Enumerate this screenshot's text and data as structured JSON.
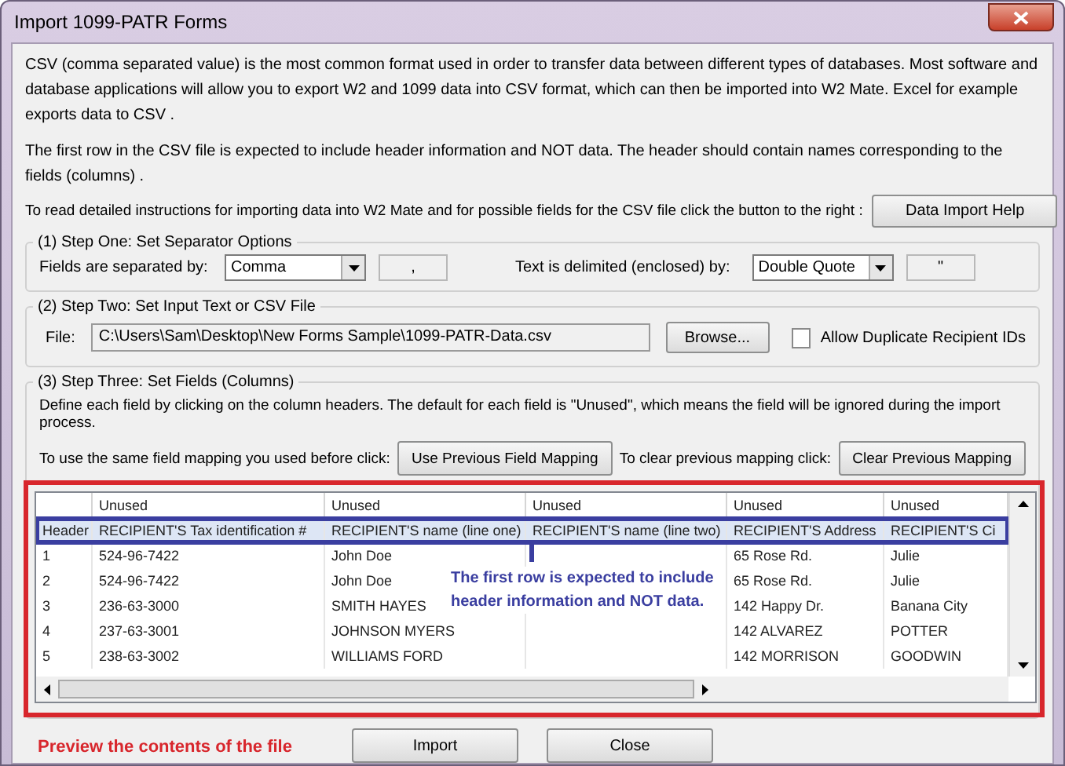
{
  "window": {
    "title": "Import 1099-PATR Forms"
  },
  "description": [
    "CSV (comma separated value) is the most common format used in order to transfer data between different types of databases.  Most software and database applications will allow you to export W2 and 1099 data into CSV format, which can then be imported into W2 Mate. Excel for example exports data to CSV .",
    "The first row in the CSV file is expected to include header information and NOT data. The header should contain names corresponding to the fields (columns) ."
  ],
  "help_row": {
    "text": "To read detailed instructions for importing data into W2 Mate and for possible fields for the CSV file click the button to the right :",
    "button": "Data Import Help"
  },
  "step1": {
    "legend": "(1)  Step One: Set Separator Options",
    "fields_label": "Fields are separated by:",
    "fields_select": "Comma",
    "fields_char": ",",
    "text_label": "Text is delimited (enclosed) by:",
    "text_select": "Double Quote",
    "text_char": "\""
  },
  "step2": {
    "legend": "(2)  Step Two: Set Input Text or CSV File",
    "file_label": "File:",
    "file_value": "C:\\Users\\Sam\\Desktop\\New Forms Sample\\1099-PATR-Data.csv",
    "browse_button": "Browse...",
    "allow_duplicates": {
      "label": "Allow Duplicate Recipient IDs",
      "checked": false
    }
  },
  "step3": {
    "legend": "(3)  Step Three: Set Fields (Columns)",
    "instructions": "Define each field by clicking on the column headers. The default for each field is \"Unused\", which means the field will be ignored during the import process.",
    "use_prev_text": "To use the same field mapping you used before click:",
    "use_prev_button": "Use Previous Field Mapping",
    "clear_text": "To clear previous mapping click:",
    "clear_button": "Clear Previous Mapping"
  },
  "table": {
    "columns": [
      "Unused",
      "Unused",
      "Unused",
      "Unused",
      "Unused"
    ],
    "header_row": {
      "label": "Header",
      "cells": [
        "RECIPIENT'S Tax identification #",
        "RECIPIENT'S name (line one)",
        "RECIPIENT'S name (line two)",
        "RECIPIENT'S Address",
        "RECIPIENT'S Ci"
      ]
    },
    "rows": [
      {
        "label": "1",
        "cells": [
          "524-96-7422",
          "John Doe",
          "",
          "65 Rose Rd.",
          "Julie"
        ]
      },
      {
        "label": "2",
        "cells": [
          "524-96-7422",
          "John Doe",
          "",
          "65 Rose Rd.",
          "Julie"
        ]
      },
      {
        "label": "3",
        "cells": [
          "236-63-3000",
          "SMITH HAYES",
          "",
          "142 Happy Dr.",
          "Banana City"
        ]
      },
      {
        "label": "4",
        "cells": [
          "237-63-3001",
          "JOHNSON MYERS",
          "",
          "142 ALVAREZ",
          "POTTER"
        ]
      },
      {
        "label": "5",
        "cells": [
          "238-63-3002",
          "WILLIAMS FORD",
          "",
          "142 MORRISON",
          "GOODWIN"
        ]
      }
    ]
  },
  "annotations": {
    "callout": "The first row is expected to include header information and NOT data.",
    "preview_note": "Preview the contents of the file"
  },
  "buttons": [
    "Import",
    "Close"
  ]
}
